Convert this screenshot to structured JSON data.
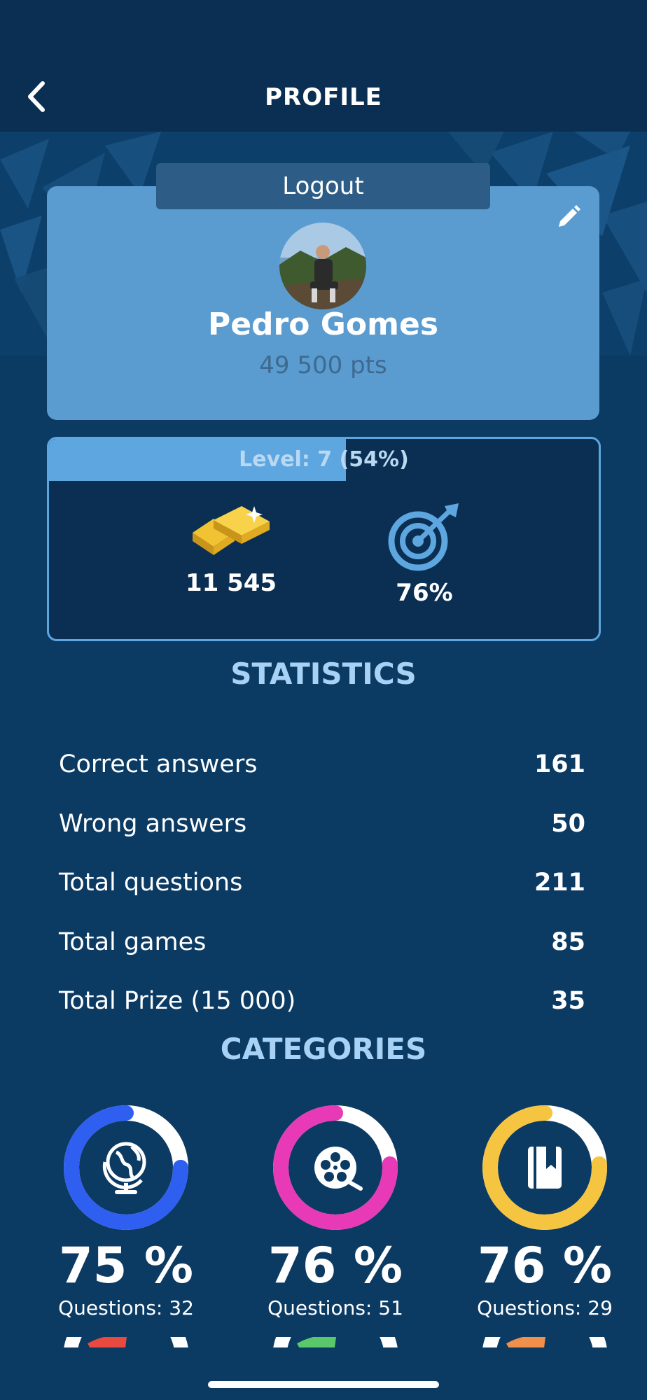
{
  "nav": {
    "title": "PROFILE"
  },
  "profile": {
    "logout_label": "Logout",
    "name": "Pedro Gomes",
    "points": "49 500 pts"
  },
  "level": {
    "label": "Level: 7 (54%)",
    "progress": 0.54
  },
  "stats_summary": {
    "gold": "11 545",
    "accuracy": "76%"
  },
  "statistics": {
    "title": "STATISTICS",
    "rows": [
      {
        "label": "Correct answers",
        "value": "161"
      },
      {
        "label": "Wrong answers",
        "value": "50"
      },
      {
        "label": "Total questions",
        "value": "211"
      },
      {
        "label": "Total games",
        "value": "85"
      },
      {
        "label": "Total Prize (15 000)",
        "value": "35"
      }
    ]
  },
  "categories": {
    "title": "CATEGORIES",
    "items": [
      {
        "icon": "globe-icon",
        "color": "#2f5ff0",
        "percent": "75 %",
        "fraction": 0.75,
        "questions": "Questions: 32"
      },
      {
        "icon": "film-reel-icon",
        "color": "#e83ab6",
        "percent": "76 %",
        "fraction": 0.76,
        "questions": "Questions: 51"
      },
      {
        "icon": "book-icon",
        "color": "#f5c542",
        "percent": "76 %",
        "fraction": 0.76,
        "questions": "Questions: 29"
      }
    ],
    "partial_colors": [
      "#e84a3f",
      "#5ac86a",
      "#f0904a"
    ]
  },
  "colors": {
    "background": "#0b3a63",
    "nav": "#0a2f52",
    "card": "#5a9bd0",
    "accent": "#5ea6e0",
    "section_title": "#a8d2f5"
  }
}
